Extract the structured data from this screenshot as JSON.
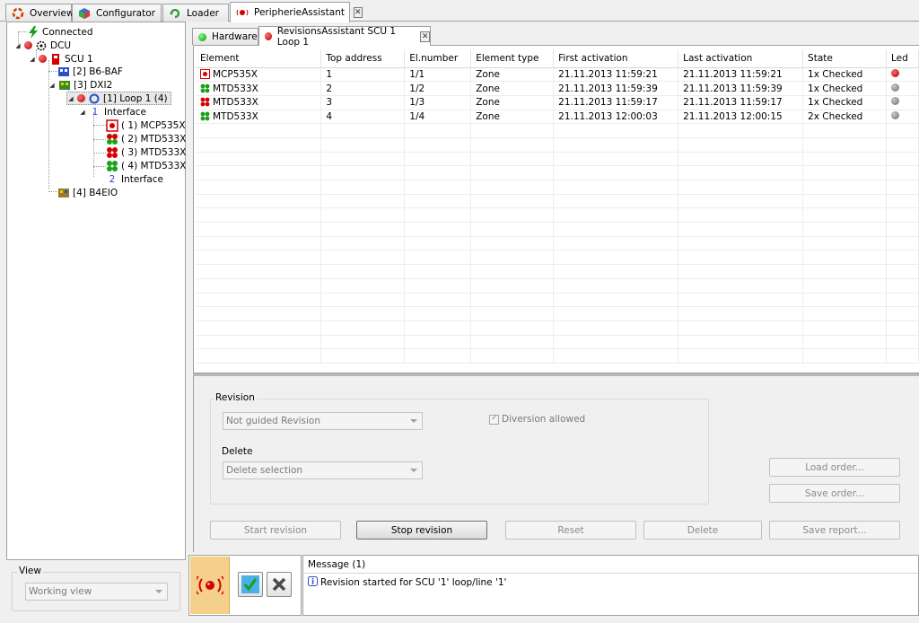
{
  "top_tabs": [
    {
      "label": "Overview",
      "icon": "overview-icon"
    },
    {
      "label": "Configurator",
      "icon": "configurator-icon"
    },
    {
      "label": "Loader",
      "icon": "loader-icon"
    },
    {
      "label": "PeripherieAssistant",
      "icon": "peripherie-icon",
      "active": true
    }
  ],
  "tree": {
    "connected": "Connected",
    "dcu": "DCU",
    "scu": "SCU 1",
    "b6baf": "[2] B6-BAF",
    "dxi2": "[3] DXI2",
    "loop": "[1] Loop 1 (4)",
    "interface1_num": "1",
    "interface1": "Interface",
    "dev1": "( 1) MCP535X",
    "dev2": "( 2) MTD533X",
    "dev3": "( 3) MTD533X",
    "dev4": "( 4) MTD533X",
    "interface2_num": "2",
    "interface2": "Interface",
    "b4eio": "[4] B4EIO"
  },
  "view": {
    "label": "View",
    "value": "Working view"
  },
  "sub_tabs": [
    {
      "label": "Hardware",
      "status": "green"
    },
    {
      "label": "RevisionsAssistant SCU 1 Loop 1",
      "status": "red",
      "active": true
    }
  ],
  "grid": {
    "columns": [
      "Element",
      "Top address",
      "El.number",
      "Element type",
      "First activation",
      "Last activation",
      "State",
      "Led"
    ],
    "rows": [
      {
        "element": "MCP535X",
        "icon": "mcp-icon",
        "top": "1",
        "el": "1/1",
        "type": "Zone",
        "first": "21.11.2013 11:59:21",
        "last": "21.11.2013 11:59:21",
        "state": "1x Checked",
        "led": "red"
      },
      {
        "element": "MTD533X",
        "icon": "mtd-icon",
        "top": "2",
        "el": "1/2",
        "type": "Zone",
        "first": "21.11.2013 11:59:39",
        "last": "21.11.2013 11:59:39",
        "state": "1x Checked",
        "led": "gray"
      },
      {
        "element": "MTD533X",
        "icon": "mtd-red-icon",
        "top": "3",
        "el": "1/3",
        "type": "Zone",
        "first": "21.11.2013 11:59:17",
        "last": "21.11.2013 11:59:17",
        "state": "1x Checked",
        "led": "gray"
      },
      {
        "element": "MTD533X",
        "icon": "mtd-icon",
        "top": "4",
        "el": "1/4",
        "type": "Zone",
        "first": "21.11.2013 12:00:03",
        "last": "21.11.2013 12:00:15",
        "state": "2x Checked",
        "led": "gray"
      }
    ]
  },
  "revision": {
    "group_label": "Revision",
    "mode_value": "Not guided Revision",
    "diversion_label": "Diversion allowed",
    "delete_label": "Delete",
    "delete_value": "Delete selection",
    "load_order": "Load order...",
    "save_order": "Save order...",
    "start": "Start revision",
    "stop": "Stop revision",
    "reset": "Reset",
    "delete": "Delete",
    "save_report": "Save report..."
  },
  "message": {
    "header": "Message (1)",
    "text": "Revision started for SCU '1' loop/line '1'"
  },
  "colors": {
    "led_red": "#d40000",
    "led_gray": "#8c8c8c",
    "led_green": "#1aa01a",
    "action_orange": "#f5d08a"
  }
}
